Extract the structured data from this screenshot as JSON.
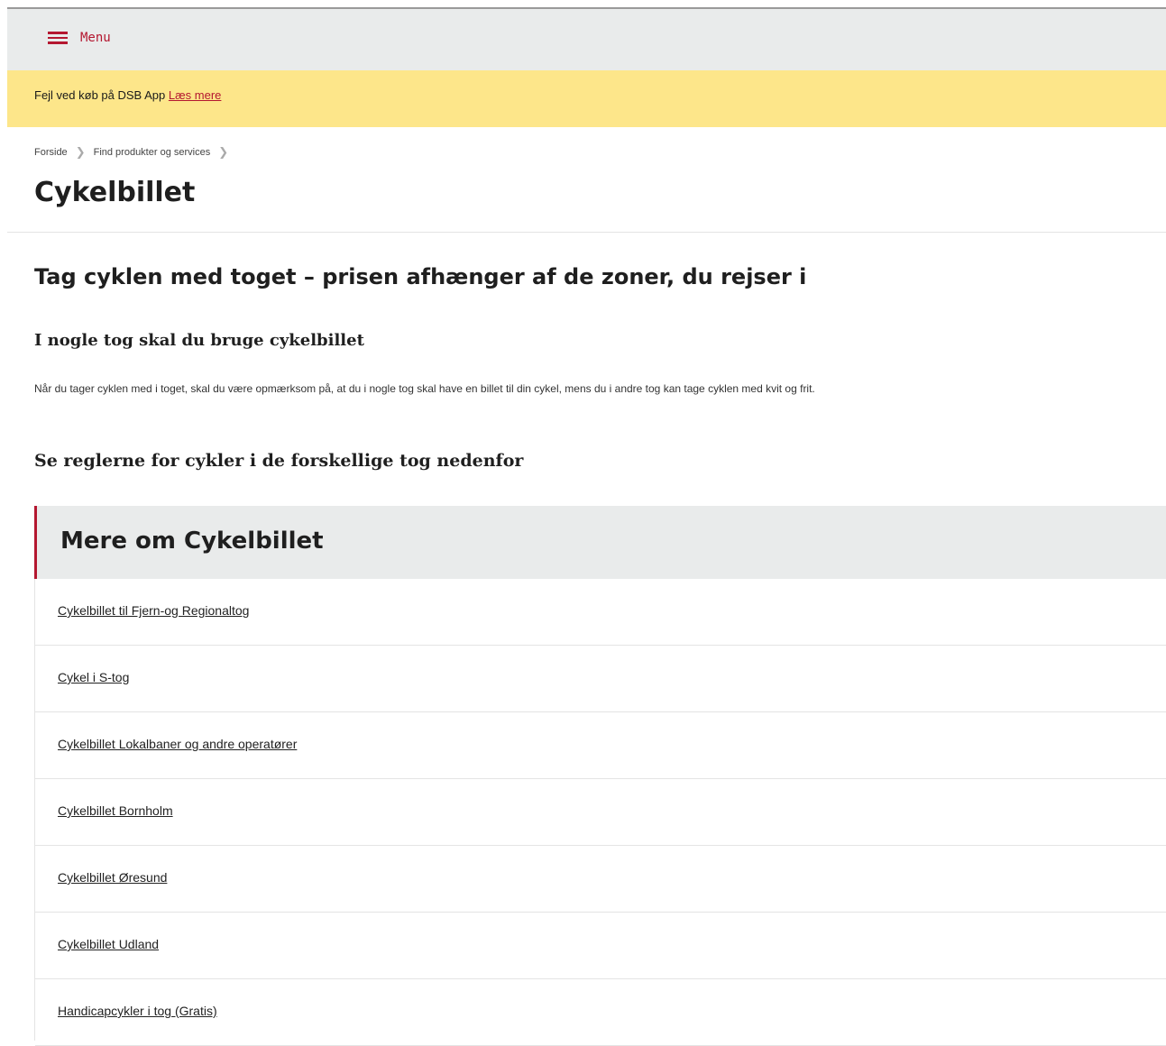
{
  "header": {
    "menu_label": "Menu",
    "menu_icon": "hamburger-icon",
    "accent_color": "#b41730"
  },
  "alert": {
    "text": "Fejl ved køb på DSB App",
    "link_label": "Læs mere",
    "background_color": "#fde68a"
  },
  "breadcrumb": {
    "items": [
      "Forside",
      "Find produkter og services"
    ],
    "separator_icon": "chevron-right-icon"
  },
  "page": {
    "title": "Cykelbillet",
    "heading": "Tag cyklen med toget – prisen afhænger af de zoner, du rejser i",
    "subheading": "I nogle tog skal du bruge cykelbillet",
    "body": "Når du tager cyklen med i toget, skal du være opmærksom på, at du i nogle tog skal have en billet til din cykel, mens du i andre tog kan tage cyklen med kvit og frit.",
    "rules_heading": "Se reglerne for cykler i de forskellige tog nedenfor"
  },
  "panel": {
    "title": "Mere om Cykelbillet",
    "links": [
      "Cykelbillet til Fjern-og Regionaltog",
      "Cykel i S-tog",
      "Cykelbillet Lokalbaner og andre operatører",
      "Cykelbillet Bornholm",
      "Cykelbillet Øresund",
      "Cykelbillet Udland",
      "Handicapcykler i tog (Gratis)"
    ]
  }
}
